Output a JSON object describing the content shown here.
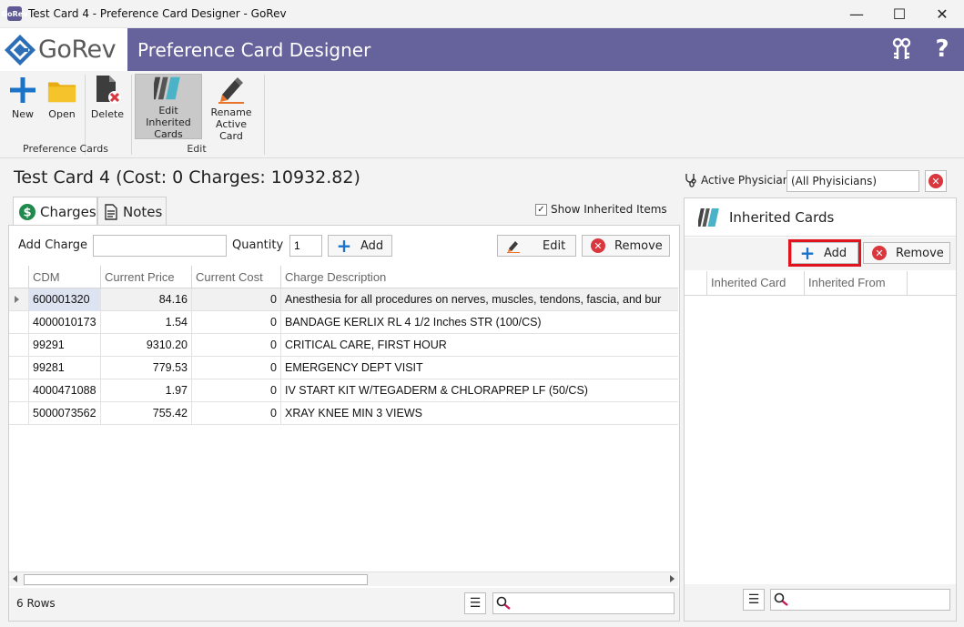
{
  "window": {
    "title": "Test Card 4 - Preference Card Designer - GoRev",
    "app_icon": "GoRev",
    "minimize": "—",
    "maximize": "☐",
    "close": "✕"
  },
  "header": {
    "brand": "GoRev",
    "heading": "Preference Card Designer",
    "keys_icon": "keys-icon",
    "help_icon": "?"
  },
  "ribbon": {
    "buttons": {
      "new": "New",
      "open": "Open",
      "delete": "Delete",
      "edit_inherited_line1": "Edit Inherited",
      "edit_inherited_line2": "Cards",
      "rename_line1": "Rename",
      "rename_line2": "Active Card"
    },
    "groups": {
      "preference_cards": "Preference Cards",
      "edit": "Edit"
    }
  },
  "card": {
    "title": "Test Card 4 (Cost: 0 Charges: 10932.82)"
  },
  "physician": {
    "label": "Active Physician",
    "value": "(All Phyisicians)"
  },
  "tabs": {
    "charges": "Charges",
    "notes": "Notes"
  },
  "show_inherited": {
    "label": "Show Inherited Items",
    "checked": true
  },
  "charge_toolbar": {
    "add_charge_label": "Add Charge",
    "add_charge_value": "",
    "quantity_label": "Quantity",
    "quantity_value": "1",
    "add": "Add",
    "edit": "Edit",
    "remove": "Remove"
  },
  "grid": {
    "columns": [
      "CDM",
      "Current Price",
      "Current Cost",
      "Charge Description"
    ],
    "rows": [
      [
        "600001320",
        "84.16",
        "0",
        "Anesthesia for all procedures on nerves, muscles, tendons, fascia, and bur"
      ],
      [
        "4000010173",
        "1.54",
        "0",
        "BANDAGE KERLIX RL 4 1/2 Inches  STR (100/CS)"
      ],
      [
        "99291",
        "9310.20",
        "0",
        "CRITICAL CARE, FIRST HOUR"
      ],
      [
        "99281",
        "779.53",
        "0",
        "EMERGENCY DEPT VISIT"
      ],
      [
        "4000471088",
        "1.97",
        "0",
        "IV START KIT W/TEGADERM & CHLORAPREP LF (50/CS)"
      ],
      [
        "5000073562",
        "755.42",
        "0",
        "XRAY KNEE MIN 3 VIEWS"
      ]
    ],
    "row_count": "6 Rows"
  },
  "inherited": {
    "title": "Inherited Cards",
    "add": "Add",
    "remove": "Remove",
    "columns": [
      "Inherited Card",
      "Inherited From"
    ]
  },
  "colors": {
    "header_bg": "#66629b",
    "accent_blue": "#1a73c9",
    "danger_red": "#d9363e",
    "highlight": "#e0141e"
  }
}
